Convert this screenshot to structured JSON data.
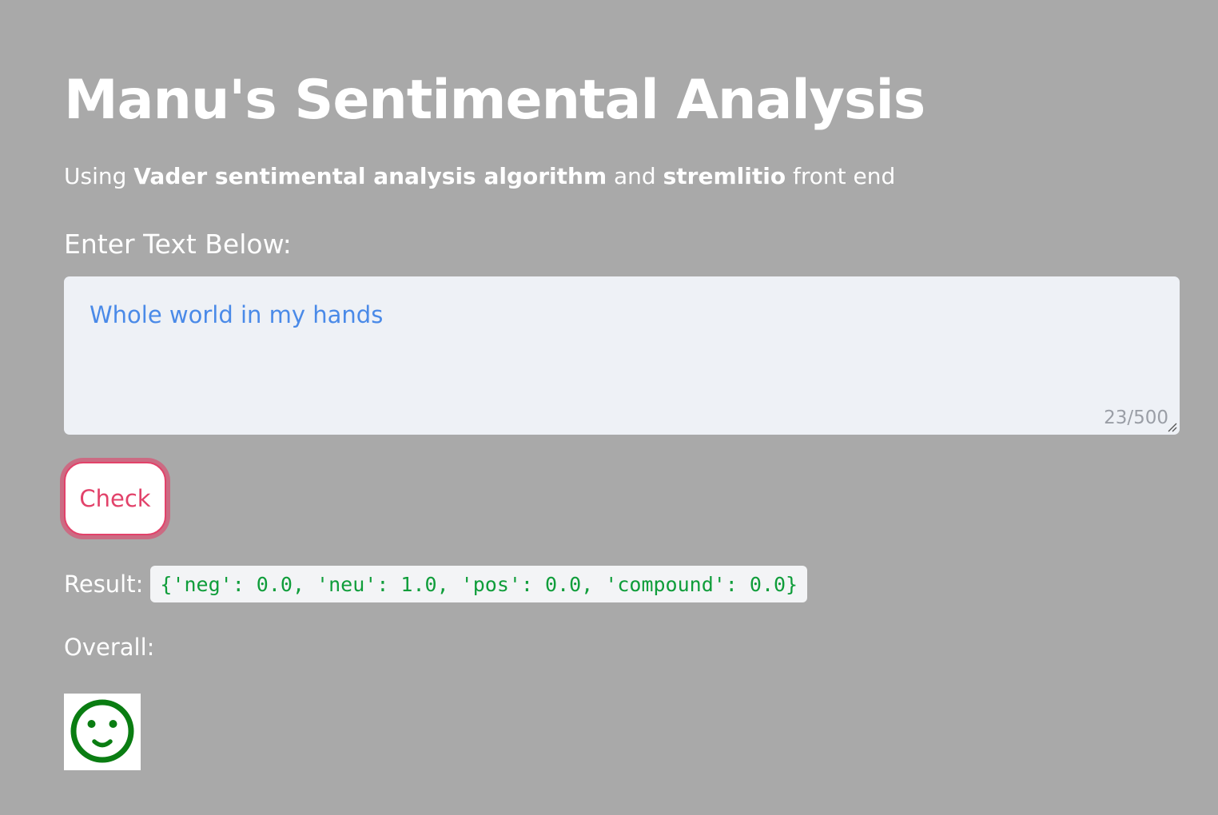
{
  "header": {
    "title": "Manu's Sentimental Analysis",
    "subtitle": {
      "prefix": "Using ",
      "bold1": "Vader sentimental analysis algorithm",
      "middle": " and ",
      "bold2": "stremlitio",
      "suffix": " front end"
    }
  },
  "input": {
    "label": "Enter Text Below:",
    "value": "Whole world in my hands",
    "char_count": "23/500"
  },
  "actions": {
    "check_label": "Check"
  },
  "result": {
    "label": "Result:",
    "value": "{'neg': 0.0, 'neu': 1.0, 'pos': 0.0, 'compound': 0.0}"
  },
  "overall": {
    "label": "Overall:",
    "icon": "smiley-face-icon",
    "icon_color": "#0a7d12"
  },
  "colors": {
    "background": "#a9a9a9",
    "accent": "#e2426a",
    "input_text": "#4a8ae8",
    "code_text": "#0f9d3a"
  }
}
